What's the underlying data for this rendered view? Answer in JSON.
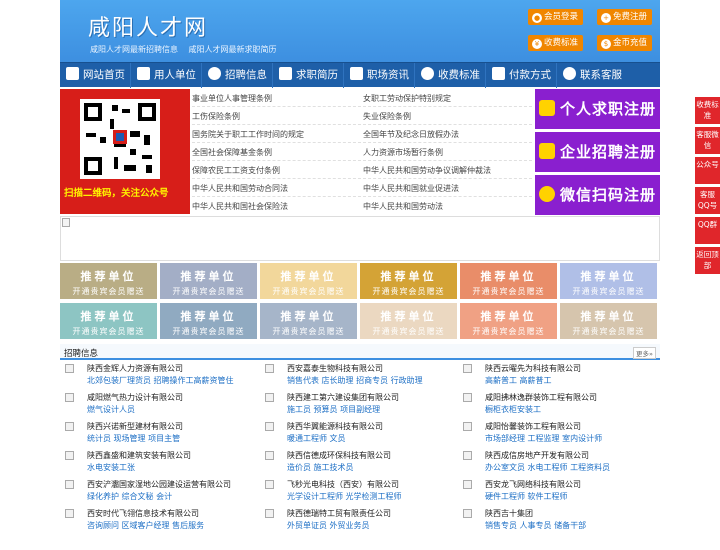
{
  "header": {
    "logo": "咸阳人才网",
    "tagline": [
      "咸阳人才网最新招聘信息",
      "咸阳人才网最新求职简历"
    ],
    "buttons": [
      {
        "label": "会员登录",
        "icon": "user-icon"
      },
      {
        "label": "免费注册",
        "icon": "user-plus-icon"
      },
      {
        "label": "收费标准",
        "icon": "yen-icon"
      },
      {
        "label": "金币充值",
        "icon": "coin-icon"
      }
    ]
  },
  "nav": [
    {
      "label": "网站首页",
      "icon": "home-icon"
    },
    {
      "label": "用人单位",
      "icon": "building-icon"
    },
    {
      "label": "招聘信息",
      "icon": "people-icon"
    },
    {
      "label": "求职简历",
      "icon": "resume-icon"
    },
    {
      "label": "职场资讯",
      "icon": "news-icon"
    },
    {
      "label": "收费标准",
      "icon": "yen-icon"
    },
    {
      "label": "付款方式",
      "icon": "card-icon"
    },
    {
      "label": "联系客服",
      "icon": "phone-icon"
    }
  ],
  "qr_caption": "扫描二维码，关注公众号",
  "laws": [
    "事业单位人事管理条例",
    "女职工劳动保护特别规定",
    "工伤保险条例",
    "失业保险条例",
    "国务院关于职工工作时间的规定",
    "全国年节及纪念日放假办法",
    "全国社会保障基金条例",
    "人力资源市场暂行条例",
    "保障农民工工资支付条例",
    "中华人民共和国劳动争议调解仲裁法",
    "中华人民共和国劳动合同法",
    "中华人民共和国就业促进法",
    "中华人民共和国社会保险法",
    "中华人民共和国劳动法"
  ],
  "register": [
    {
      "label": "个人求职注册",
      "icon": "person-icon"
    },
    {
      "label": "企业招聘注册",
      "icon": "company-icon"
    },
    {
      "label": "微信扫码注册",
      "icon": "wechat-icon"
    }
  ],
  "recommend": {
    "title": "推荐单位",
    "subtitle": "开通贵宾会员赠送",
    "colors": [
      "#b9ad85",
      "#a3aec6",
      "#f2d79b",
      "#d4a336",
      "#e98d69",
      "#b0bfe7",
      "#8dc5c3",
      "#90aac1",
      "#a6b5c9",
      "#ebd8c1",
      "#f0a184",
      "#d6c5ad"
    ]
  },
  "jobs_section": {
    "title": "招聘信息",
    "more": "更多»"
  },
  "jobs": [
    {
      "company": "陕西金辉人力资源有限公司",
      "positions": "北郊包装厂理货员 招聘操作工高薪资管住"
    },
    {
      "company": "西安嘉泰生物科技有限公司",
      "positions": "销售代表 店长助理 招商专员 行政助理"
    },
    {
      "company": "陕西云曜先为科技有限公司",
      "positions": "高薪普工 高薪普工"
    },
    {
      "company": "咸阳燃气热力设计有限公司",
      "positions": "燃气设计人员"
    },
    {
      "company": "陕西建工第六建设集团有限公司",
      "positions": "施工员 预算员 项目副经理"
    },
    {
      "company": "咸阳拂林逸群装饰工程有限公司",
      "positions": "橱柜衣柜安装工"
    },
    {
      "company": "陕西兴诺新型建材有限公司",
      "positions": "统计员 现场管理 项目主管"
    },
    {
      "company": "陕西华翼能源科技有限公司",
      "positions": "暖通工程师 文员"
    },
    {
      "company": "咸阳怡馨装饰工程有限公司",
      "positions": "市场部经理 工程监理 室内设计师"
    },
    {
      "company": "陕西鑫盛和建筑安装有限公司",
      "positions": "水电安装工张"
    },
    {
      "company": "陕西信德成环保科技有限公司",
      "positions": "造价员 施工技术员"
    },
    {
      "company": "陕西成信房地产开发有限公司",
      "positions": "办公室文员 水电工程师 工程资料员"
    },
    {
      "company": "西安浐灞国家湿地公园建设运营有限公司",
      "positions": "绿化养护 综合文秘 会计"
    },
    {
      "company": "飞秒光电科技（西安）有限公司",
      "positions": "光学设计工程师 光学检测工程师"
    },
    {
      "company": "西安龙飞网络科技有限公司",
      "positions": "硬件工程师 软件工程师"
    },
    {
      "company": "西安时代飞翎信息技术有限公司",
      "positions": "咨询顾问 区域客户经理 售后服务"
    },
    {
      "company": "陕西德瑞特工贸有限责任公司",
      "positions": "外贸单证员 外贸业务员"
    },
    {
      "company": "陕西吉十集团",
      "positions": "销售专员 人事专员 储备干部"
    }
  ],
  "float_bar": [
    "收费标准",
    "客服微信",
    "公众号",
    "客服QQ号",
    "QQ群",
    "返回顶部"
  ]
}
